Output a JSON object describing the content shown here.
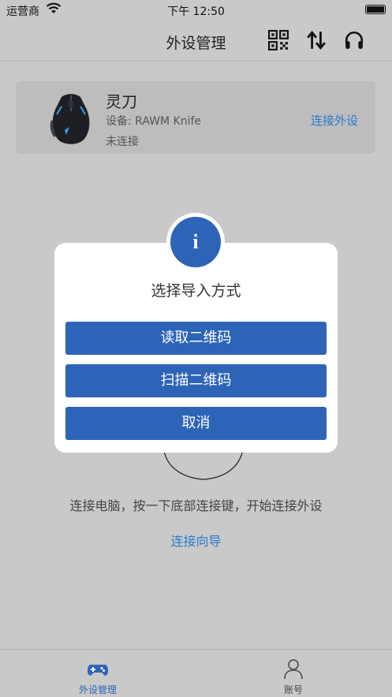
{
  "status_bar": {
    "carrier": "运营商",
    "time": "下午 12:50"
  },
  "nav": {
    "title": "外设管理",
    "icons": [
      "qr-code-icon",
      "sort-arrows-icon",
      "headset-icon"
    ]
  },
  "device": {
    "name": "灵刀",
    "model": "设备: RAWM Knife",
    "status": "未连接",
    "connect_label": "连接外设"
  },
  "hint": {
    "text": "连接电脑，按一下底部连接键，开始连接外设",
    "guide_label": "连接向导"
  },
  "dialog": {
    "badge": "i",
    "title": "选择导入方式",
    "buttons": [
      "读取二维码",
      "扫描二维码",
      "取消"
    ]
  },
  "tabs": [
    {
      "label": "外设管理",
      "icon": "gamepad-icon",
      "active": true
    },
    {
      "label": "账号",
      "icon": "person-icon",
      "active": false
    }
  ],
  "colors": {
    "accent": "#2d64b7",
    "link": "#2a7ccf",
    "active_tab": "#2d64b7",
    "inactive_tab": "#444444"
  }
}
